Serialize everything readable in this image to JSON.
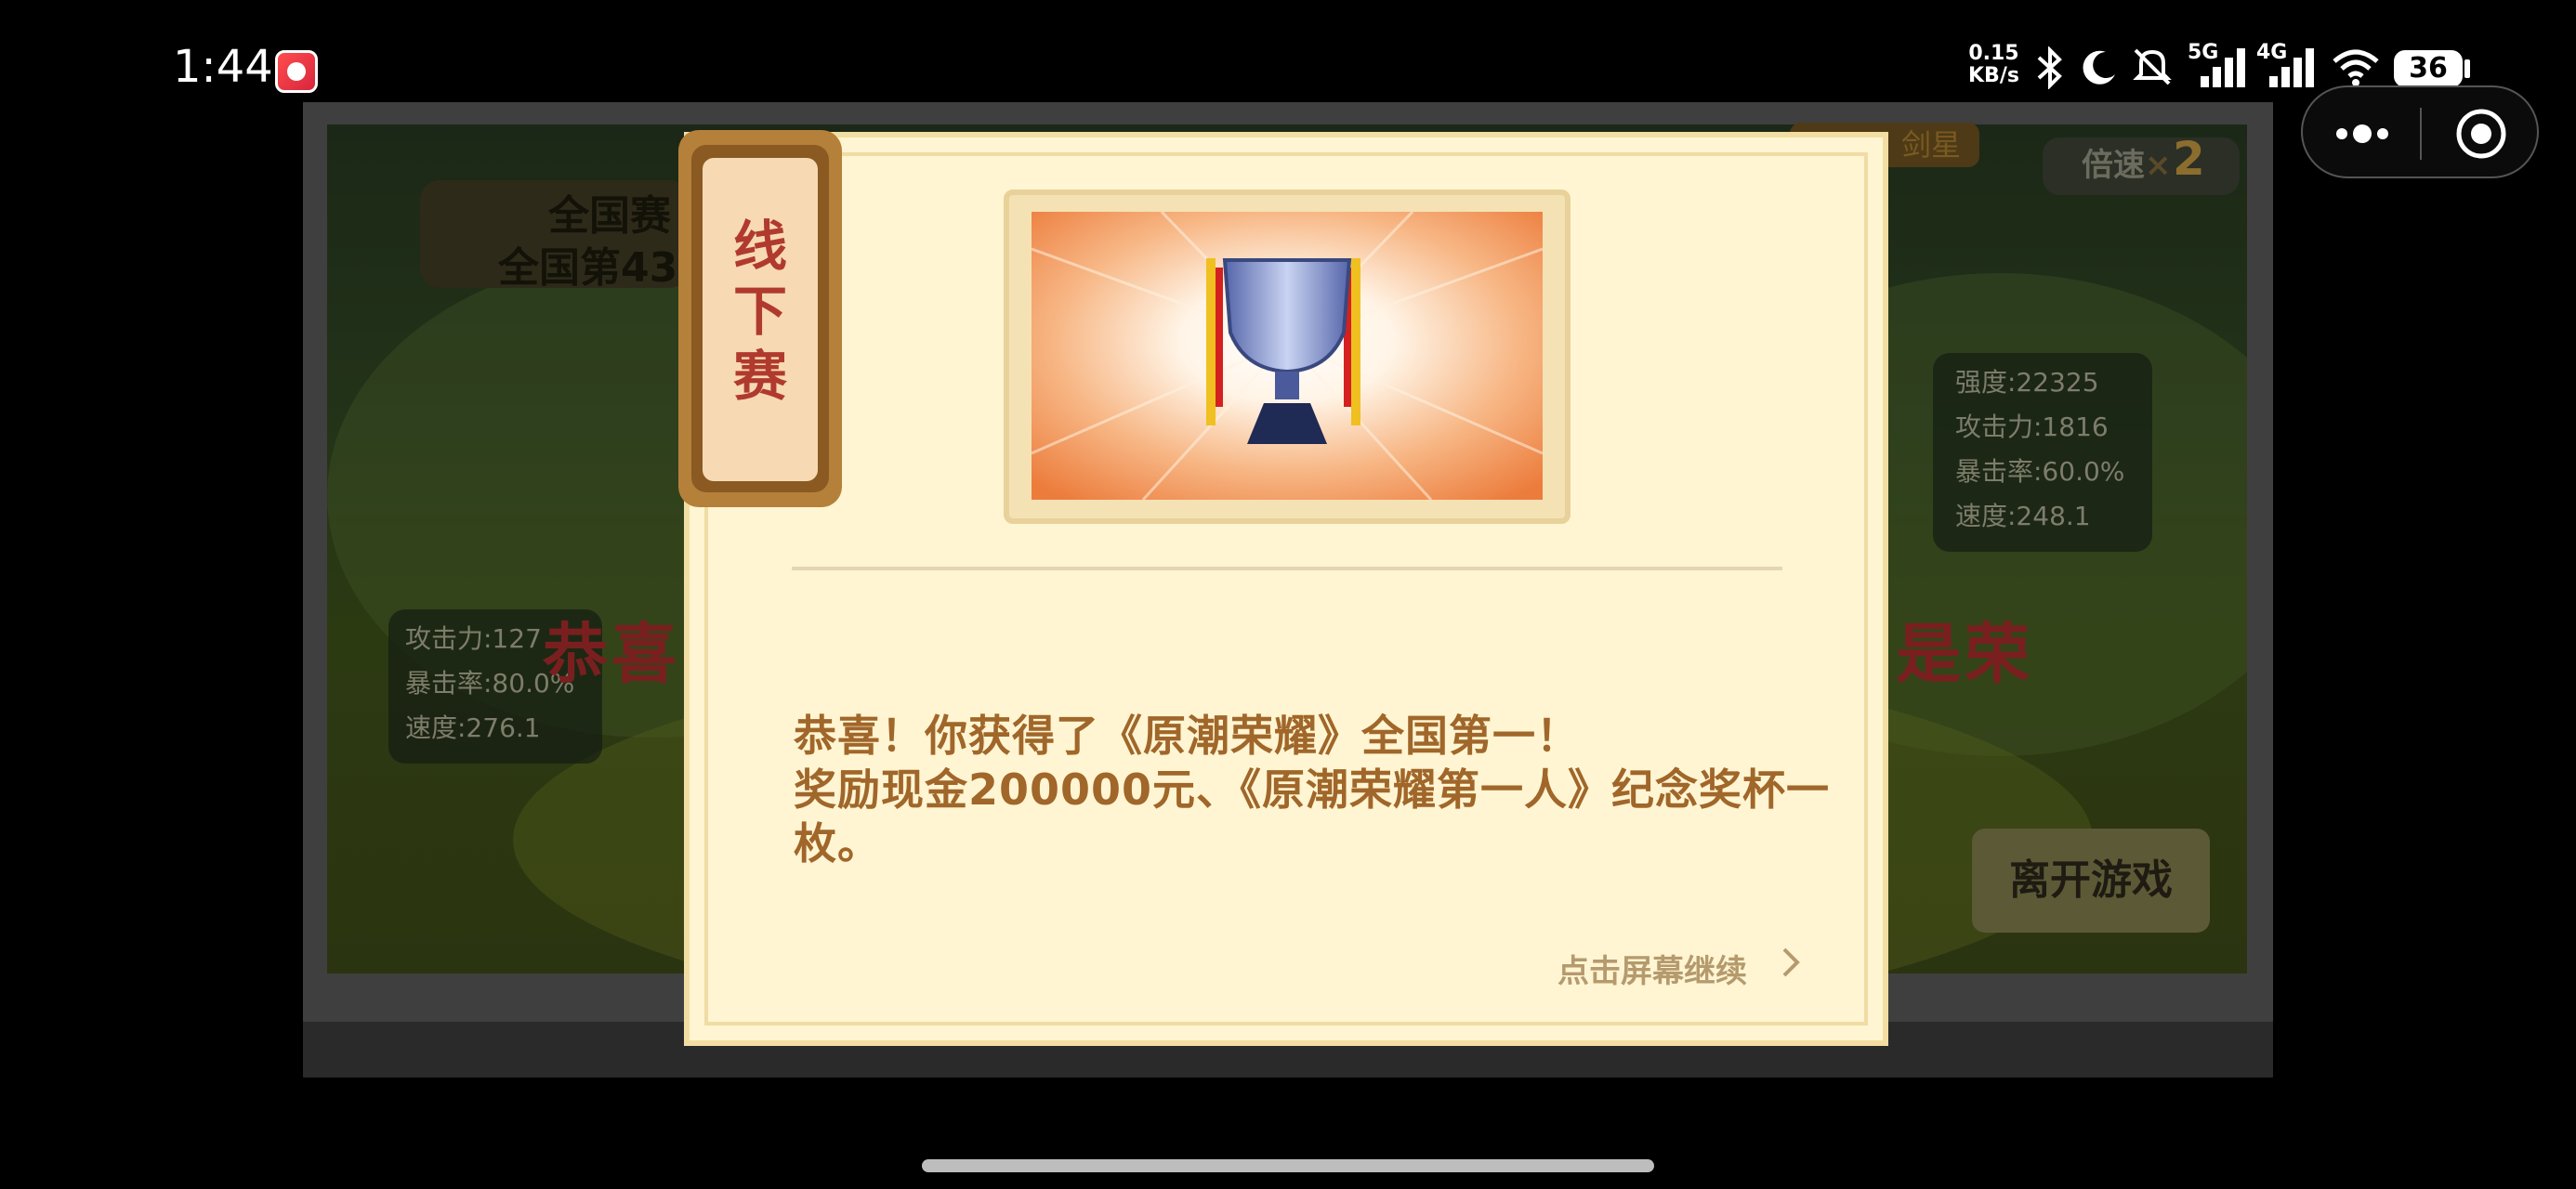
{
  "status_bar": {
    "time": "1:44",
    "net_speed_value": "0.15",
    "net_speed_unit": "KB/s",
    "network_5g": "5G",
    "network_4g": "4G",
    "battery": "36",
    "icons": [
      "bluetooth-icon",
      "moon-icon",
      "mute-icon",
      "signal-5g-icon",
      "signal-4g-icon",
      "wifi-icon",
      "battery-icon"
    ]
  },
  "capsule": {
    "more_icon": "more-dots-icon",
    "close_icon": "target-close-icon"
  },
  "background_game": {
    "title": "全国赛",
    "subtitle": "全国第43",
    "speed_label": "倍速",
    "speed_x": "×",
    "speed_value": "2",
    "gold_tag": "剑星",
    "left_stats": [
      "攻击力:127",
      "暴击率:80.0%",
      "速度:276.1"
    ],
    "right_stats": [
      "强度:22325",
      "攻击力:1816",
      "暴击率:60.0%",
      "速度:248.1"
    ],
    "red_left": "恭喜",
    "red_right": "是荣",
    "leave_button": "离开游戏"
  },
  "modal": {
    "tab_label_lines": [
      "线",
      "下",
      "赛"
    ],
    "message_lines": [
      "恭喜！你获得了《原潮荣耀》全国第一！",
      "奖励现金200000元、《原潮荣耀第一人》纪念奖杯一",
      "枚。"
    ],
    "continue_text": "点击屏幕继续",
    "continue_icon": "chevron-right-icon",
    "trophy_icon": "trophy-icon"
  },
  "colors": {
    "modal_bg": "#fff5d2",
    "message_text": "#a0662a",
    "tab_text": "#b03a2e",
    "continue_text": "#b59a6e"
  }
}
